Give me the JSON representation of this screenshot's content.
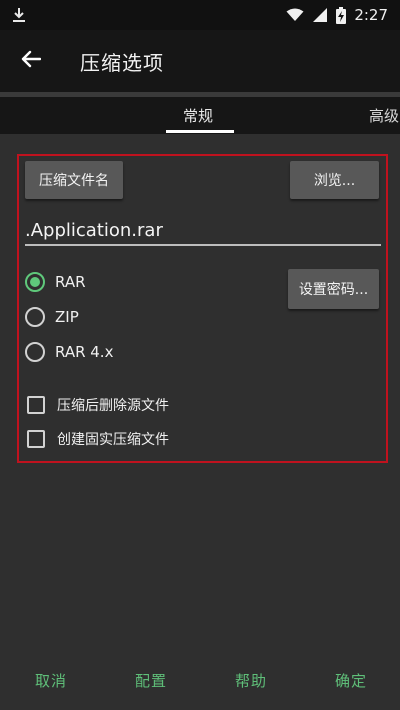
{
  "status_bar": {
    "time": "2:27",
    "icons": [
      "download-icon",
      "wifi-icon",
      "signal-icon",
      "battery-charging-icon"
    ]
  },
  "app_bar": {
    "title": "压缩选项",
    "back_icon": "arrow-left-icon"
  },
  "tabs": [
    {
      "label": "常规",
      "selected": true
    },
    {
      "label": "高级",
      "selected": false
    }
  ],
  "general": {
    "archive_name_button": "压缩文件名",
    "browse_button": "浏览...",
    "archive_name_value": ".Application.rar",
    "set_password_button": "设置密码...",
    "format_options": [
      {
        "label": "RAR",
        "checked": true
      },
      {
        "label": "ZIP",
        "checked": false
      },
      {
        "label": "RAR 4.x",
        "checked": false
      }
    ],
    "checkbox_options": [
      {
        "label": "压缩后删除源文件",
        "checked": false
      },
      {
        "label": "创建固实压缩文件",
        "checked": false
      }
    ]
  },
  "bottom_actions": {
    "cancel": "取消",
    "config": "配置",
    "help": "帮助",
    "ok": "确定"
  },
  "colors": {
    "accent": "#5fc97b",
    "highlight_frame": "#c0121e",
    "background": "#2f2f2f",
    "bar": "#161616"
  }
}
